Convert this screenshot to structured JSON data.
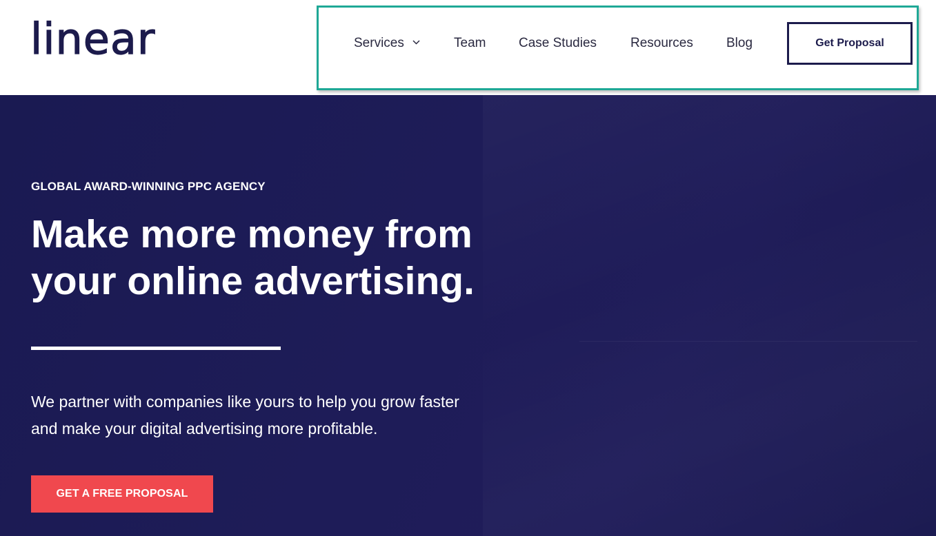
{
  "header": {
    "logo": "linear",
    "nav": {
      "items": [
        {
          "label": "Services",
          "has_dropdown": true,
          "icon": "chevron-down-icon"
        },
        {
          "label": "Team"
        },
        {
          "label": "Case Studies"
        },
        {
          "label": "Resources"
        },
        {
          "label": "Blog"
        }
      ],
      "cta_label": "Get Proposal",
      "highlight_color": "#1ea896"
    }
  },
  "hero": {
    "eyebrow": "GLOBAL AWARD-WINNING PPC AGENCY",
    "headline": {
      "line1": "Make more money from",
      "line2": "your online advertising."
    },
    "subtext": {
      "line1": "We partner with companies like yours to help you grow faster",
      "line2": "and make your digital advertising more profitable."
    },
    "cta_label": "GET A FREE PROPOSAL"
  },
  "colors": {
    "brand_navy": "#1c1b4c",
    "hero_background": "#1e1c58",
    "cta_red": "#f0484e",
    "white": "#ffffff"
  }
}
